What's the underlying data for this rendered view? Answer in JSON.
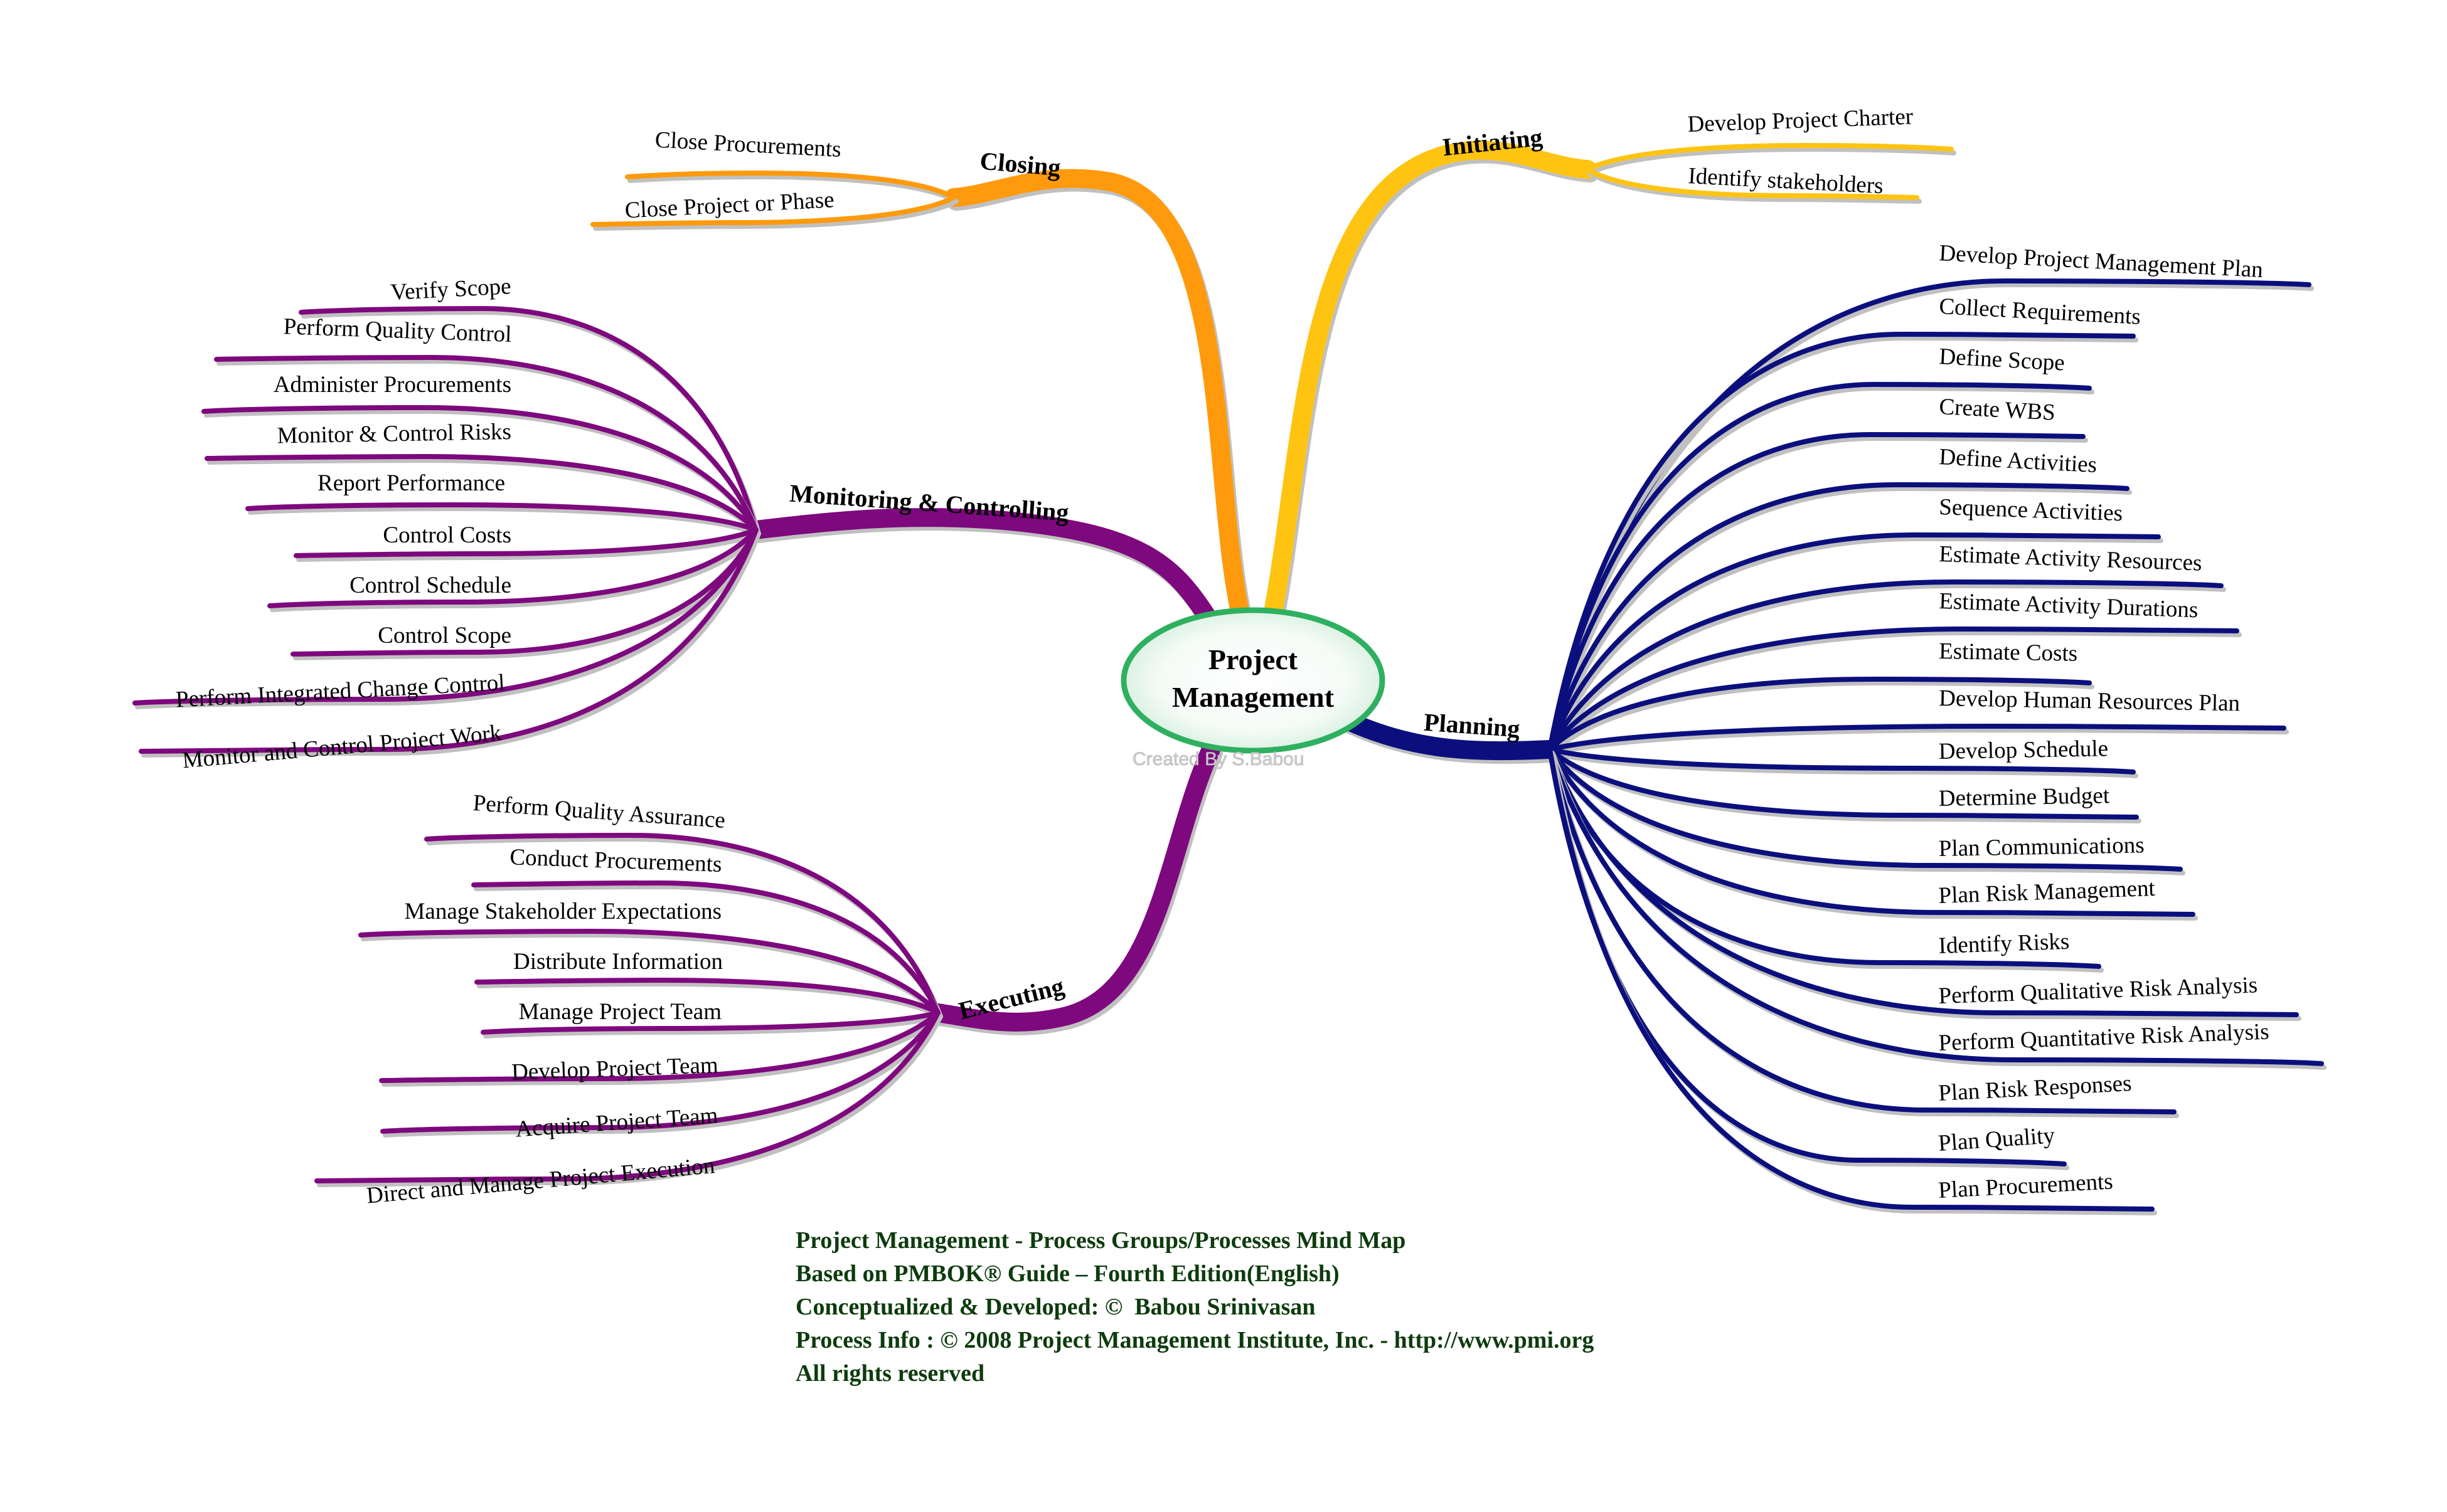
{
  "center": {
    "title_line1": "Project",
    "title_line2": "Management",
    "watermark": "Created By S.Babou",
    "fill_color": "#e6f5ea",
    "border_color": "#2fb060"
  },
  "branches": [
    {
      "id": "initiating",
      "label": "Initiating",
      "color": "#ffc412",
      "children": [
        "Develop Project Charter",
        "Identify stakeholders"
      ]
    },
    {
      "id": "planning",
      "label": "Planning",
      "color": "#0b0f7d",
      "children": [
        "Develop Project Management Plan",
        "Collect Requirements",
        "Define Scope",
        "Create WBS",
        "Define Activities",
        "Sequence Activities",
        "Estimate Activity Resources",
        "Estimate Activity Durations",
        "Estimate Costs",
        "Develop Human Resources Plan",
        "Develop Schedule",
        "Determine Budget",
        "Plan  Communications",
        "Plan  Risk Management",
        "Identify  Risks",
        "Perform Qualitative  Risk Analysis",
        "Perform Quantitative  Risk Analysis",
        "Plan  Risk Responses",
        "Plan Quality",
        "Plan  Procurements"
      ]
    },
    {
      "id": "executing",
      "label": "Executing",
      "color": "#7e087e",
      "children": [
        "Perform Quality  Assurance",
        "Conduct Procurements",
        "Manage Stakeholder Expectations",
        "Distribute Information",
        "Manage Project Team",
        "Develop Project Team",
        "Acquire Project Team",
        "Direct and  Manage Project Execution"
      ]
    },
    {
      "id": "monitoring",
      "label": "Monitoring & Controlling",
      "color": "#7e087e",
      "children": [
        "Verify Scope",
        "Perform Quality Control",
        "Administer  Procurements",
        "Monitor &  Control Risks",
        "Report Performance",
        "Control Costs",
        "Control Schedule",
        "Control Scope",
        "Perform Integrated Change Control",
        "Monitor and Control Project Work"
      ]
    },
    {
      "id": "closing",
      "label": "Closing",
      "color": "#ff9a0c",
      "children": [
        "Close  Procurements",
        "Close Project  or Phase"
      ]
    }
  ],
  "footer": {
    "line1": "Project Management - Process Groups/Processes Mind Map",
    "line2": "Based on PMBOK® Guide – Fourth Edition(English)",
    "line3": "Conceptualized & Developed: ©  Babou Srinivasan",
    "line4": "Process Info : © 2008 Project Management Institute, Inc. - http://www.pmi.org",
    "line5": "All rights reserved",
    "color": "#0d3b0d"
  }
}
